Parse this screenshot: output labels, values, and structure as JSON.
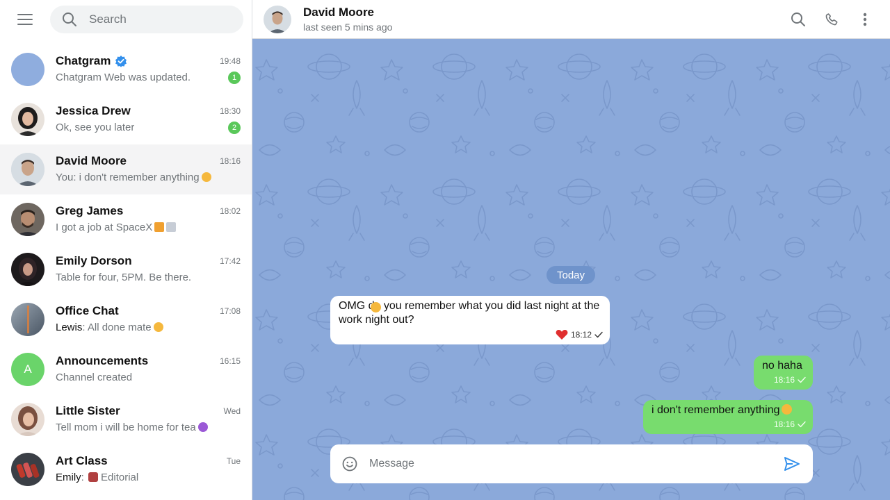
{
  "search": {
    "placeholder": "Search"
  },
  "chats": [
    {
      "name": "Chatgram",
      "time": "19:48",
      "preview": "Chatgram Web was updated.",
      "badge": "1",
      "verified": true,
      "avatar_color": "#8fadde"
    },
    {
      "name": "Jessica Drew",
      "time": "18:30",
      "preview": "Ok, see you later",
      "badge": "2",
      "avatar_color": "#3a3a3a"
    },
    {
      "name": "David Moore",
      "time": "18:16",
      "preview": "You: i don't remember anything",
      "active": true,
      "avatar_color": "#b9c3cc"
    },
    {
      "name": "Greg James",
      "time": "18:02",
      "preview": "I got a job at SpaceX",
      "avatar_color": "#4b4640"
    },
    {
      "name": "Emily Dorson",
      "time": "17:42",
      "preview": "Table for four, 5PM. Be there.",
      "avatar_color": "#2a2226"
    },
    {
      "name": "Office Chat",
      "time": "17:08",
      "sender": "Lewis",
      "preview": "All done mate",
      "avatar_color": "#6b7a8c"
    },
    {
      "name": "Announcements",
      "time": "16:15",
      "preview": "Channel created",
      "avatar_letter": "A",
      "avatar_color": "#6ad46a"
    },
    {
      "name": "Little Sister",
      "time": "Wed",
      "preview": "Tell mom i will be home for tea",
      "avatar_color": "#c8a08c"
    },
    {
      "name": "Art Class",
      "time": "Tue",
      "sender": "Emily",
      "preview": "Editorial",
      "avatar_color": "#3b3f46"
    }
  ],
  "sender_separator": ": ",
  "header": {
    "name": "David Moore",
    "status": "last seen 5 mins ago"
  },
  "date_label": "Today",
  "messages": [
    {
      "direction": "in",
      "text": "OMG  do you remember what you did last night at the work night out?",
      "time": "18:12"
    },
    {
      "direction": "out",
      "text": "no haha",
      "time": "18:16"
    },
    {
      "direction": "out",
      "text": "i don't remember anything",
      "time": "18:16"
    }
  ],
  "composer": {
    "placeholder": "Message"
  },
  "colors": {
    "background": "#8ba9da",
    "outgoing": "#78dc6e",
    "badge": "#5ac85a",
    "accent": "#3390ec"
  }
}
